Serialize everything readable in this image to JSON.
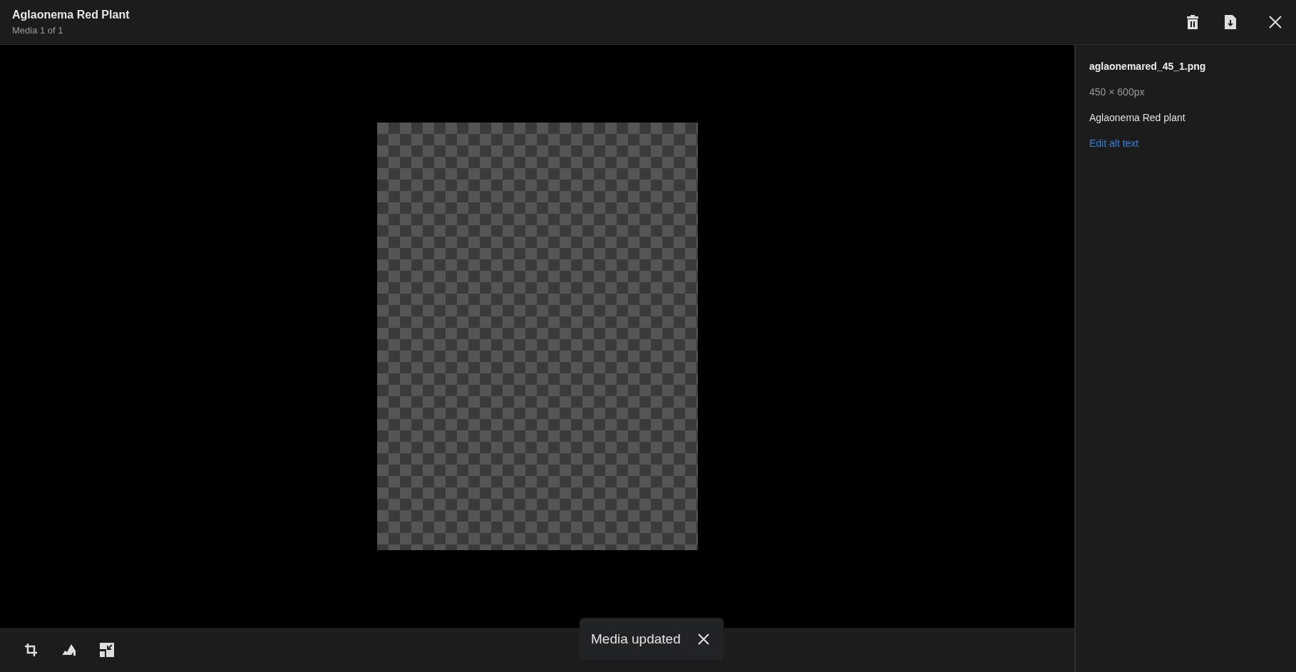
{
  "header": {
    "title": "Aglaonema Red Plant",
    "subtitle": "Media 1 of 1"
  },
  "header_actions": [
    {
      "kind": "delete"
    },
    {
      "kind": "download"
    },
    {
      "kind": "close"
    }
  ],
  "details": {
    "filename": "aglaonemared_45_1.png",
    "dimensions": "450 × 600px",
    "alt_text": "Aglaonema Red plant",
    "edit_link": "Edit alt text"
  },
  "tools": [
    {
      "kind": "crop"
    },
    {
      "kind": "focus"
    },
    {
      "kind": "resize"
    }
  ],
  "toast": {
    "message": "Media updated"
  }
}
